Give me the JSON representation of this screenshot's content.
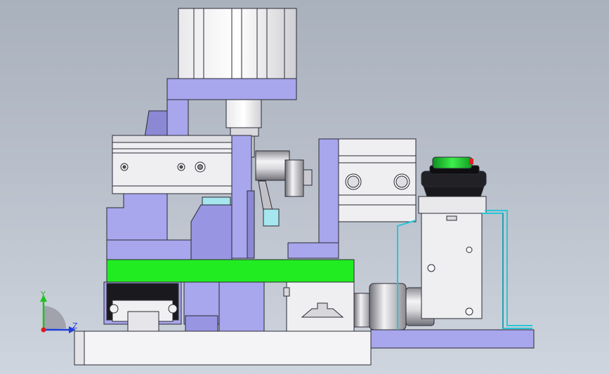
{
  "viewport": {
    "background_top": "#a9b1bd",
    "background_bottom": "#cfd5de"
  },
  "colors": {
    "lavender": "#a8a6ec",
    "lavender_dark": "#8b89d4",
    "steel_white": "#f2f2f4",
    "green_plate": "#21ec21",
    "cyan_line": "#29c6d6",
    "edge": "#2a2a34"
  },
  "triad": {
    "y_label": "Y",
    "z_label": "Z",
    "y_color": "#22c022",
    "z_color": "#1f3fd8",
    "x_color": "#e01a1a"
  }
}
